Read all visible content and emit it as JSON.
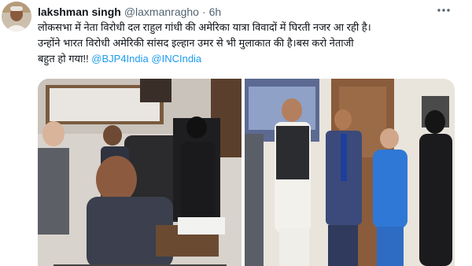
{
  "tweet": {
    "author_name": "lakshman singh",
    "author_handle": "@laxmanragho",
    "separator": "·",
    "time": "6h",
    "text_line1": "लोकसभा में नेता विरोधी दल राहुल गांधी की अमेरिका यात्रा विवादों में घिरती नजर आ रही है।",
    "text_line2": "उन्होंने भारत विरोधी अमेरिकी सांसद इल्हान उमर से भी मुलाकात की है।बस करो नेताजी",
    "text_line3_prefix": "बहुत हो गया!! ",
    "mention1": "@BJP4India",
    "mention_space": " ",
    "mention2": "@INCIndia"
  },
  "icons": {
    "more": "more-horizontal-icon"
  },
  "colors": {
    "link": "#1d9bf0",
    "secondary_text": "#536471",
    "primary_text": "#0f1419"
  }
}
